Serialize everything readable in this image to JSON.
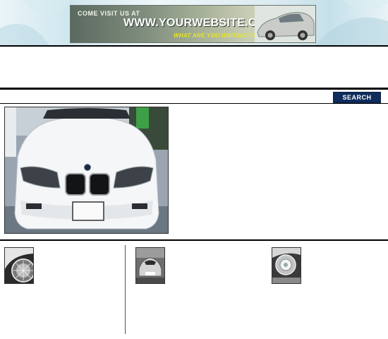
{
  "banner": {
    "line1": "COME VISIT US AT",
    "url": "WWW.YOURWEBSITE.COM",
    "tagline": "WHAT ARE YOU WAITING FOR?"
  },
  "search": {
    "label": "SEARCH"
  },
  "colors": {
    "search_button": "#0f2c5c",
    "tagline": "#e7e61e"
  },
  "images": {
    "feature": "white-bmw-z3-front-photo",
    "thumbs": [
      "chrome-wire-wheel-photo",
      "silver-lamborghini-photo",
      "headlight-closeup-photo"
    ]
  }
}
